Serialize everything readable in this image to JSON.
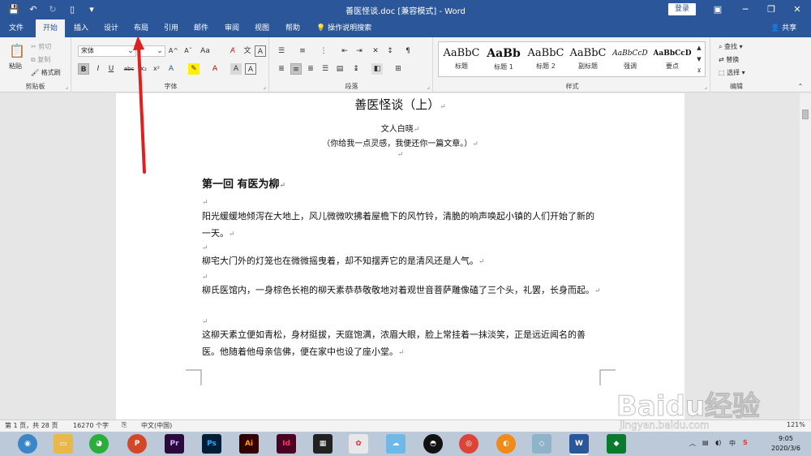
{
  "window": {
    "title": "善医怪谈.doc [兼容模式] - Word",
    "login_label": "登录"
  },
  "tabs": [
    {
      "label": "文件"
    },
    {
      "label": "开始"
    },
    {
      "label": "插入"
    },
    {
      "label": "设计"
    },
    {
      "label": "布局"
    },
    {
      "label": "引用"
    },
    {
      "label": "邮件"
    },
    {
      "label": "审阅"
    },
    {
      "label": "视图"
    },
    {
      "label": "帮助"
    }
  ],
  "active_tab": "开始",
  "tell_me": "操作说明搜索",
  "share": "共享",
  "ribbon": {
    "clipboard": {
      "paste": "粘贴",
      "cut": "剪切",
      "copy": "复制",
      "format_painter": "格式刷",
      "label": "剪贴板"
    },
    "font": {
      "font_name": "宋体",
      "label": "字体"
    },
    "paragraph": {
      "label": "段落"
    },
    "styles": {
      "label": "样式",
      "items": [
        {
          "preview": "AaBbC",
          "name": "标题"
        },
        {
          "preview": "AaBb",
          "name": "标题 1"
        },
        {
          "preview": "AaBbC",
          "name": "标题 2"
        },
        {
          "preview": "AaBbC",
          "name": "副标题"
        },
        {
          "preview": "AaBbCcD",
          "name": "强调"
        },
        {
          "preview": "AaBbCcD",
          "name": "要点"
        }
      ]
    },
    "editing": {
      "find": "查找",
      "replace": "替换",
      "select": "选择",
      "label": "编辑"
    }
  },
  "document": {
    "title": "善医怪谈（上）",
    "author": "文人白晓",
    "subtitle": "（你给我一点灵感，我便还你一篇文章。）",
    "chapter": "第一回  有医为柳",
    "paragraphs": [
      "阳光缓缓地倾泻在大地上，风儿微微吹拂着屋檐下的风竹铃，清脆的响声唤起小镇的人们开始了新的一天。",
      "柳宅大门外的灯笼也在微微摇曳着，却不知摆弄它的是清风还是人气。",
      "柳氏医馆内，一身棕色长袍的柳天素恭恭敬敬地对着观世音菩萨雕像磕了三个头，礼罢，长身而起。",
      "这柳天素立便如青松，身材挺拔，天庭饱满，浓眉大眼，脸上常挂着一抹淡笑，正是远近闻名的善医。他随着他母亲信佛，便在家中也设了座小堂。"
    ]
  },
  "status": {
    "page": "第 1 页，共 28 页",
    "words": "16270 个字",
    "language": "中文(中国)",
    "zoom": "121%"
  },
  "taskbar": {
    "time": "9:05",
    "date": "2020/3/6",
    "apps": [
      {
        "label": "Pr",
        "color": "#2a0a3a"
      },
      {
        "label": "Ps",
        "color": "#001e36"
      },
      {
        "label": "Ai",
        "color": "#330000"
      },
      {
        "label": "Id",
        "color": "#49021f"
      },
      {
        "label": "W",
        "color": "#2b579a"
      }
    ]
  },
  "watermark": {
    "logo": "Baidu经验",
    "url": "jingyan.baidu.com"
  }
}
